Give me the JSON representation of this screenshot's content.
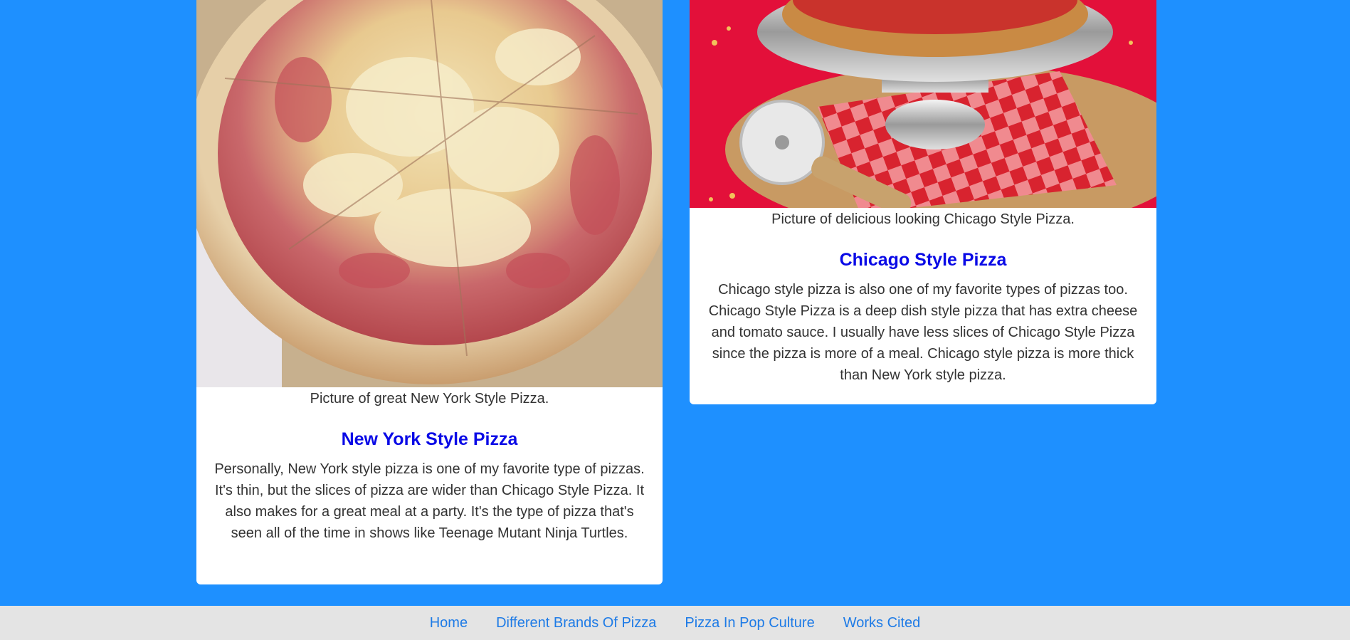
{
  "cards": [
    {
      "image_label": "new-york-pizza-photo",
      "caption": "Picture of great New York Style Pizza.",
      "title": "New York Style Pizza",
      "body": "Personally, New York style pizza is one of my favorite type of pizzas. It's thin, but the slices of pizza are wider than Chicago Style Pizza. It also makes for a great meal at a party. It's the type of pizza that's seen all of the time in shows like Teenage Mutant Ninja Turtles."
    },
    {
      "image_label": "chicago-pizza-photo",
      "caption": "Picture of delicious looking Chicago Style Pizza.",
      "title": "Chicago Style Pizza",
      "body": "Chicago style pizza is also one of my favorite types of pizzas too. Chicago Style Pizza is a deep dish style pizza that has extra cheese and tomato sauce. I usually have less slices of Chicago Style Pizza since the pizza is more of a meal. Chicago style pizza is more thick than New York style pizza."
    }
  ],
  "footer": {
    "links": [
      "Home",
      "Different Brands Of Pizza",
      "Pizza In Pop Culture",
      "Works Cited"
    ]
  },
  "colors": {
    "page_background": "#1e90ff",
    "card_title": "#0a0ae6",
    "footer_link": "#1e7be6",
    "footer_background": "#e4e4e4"
  }
}
